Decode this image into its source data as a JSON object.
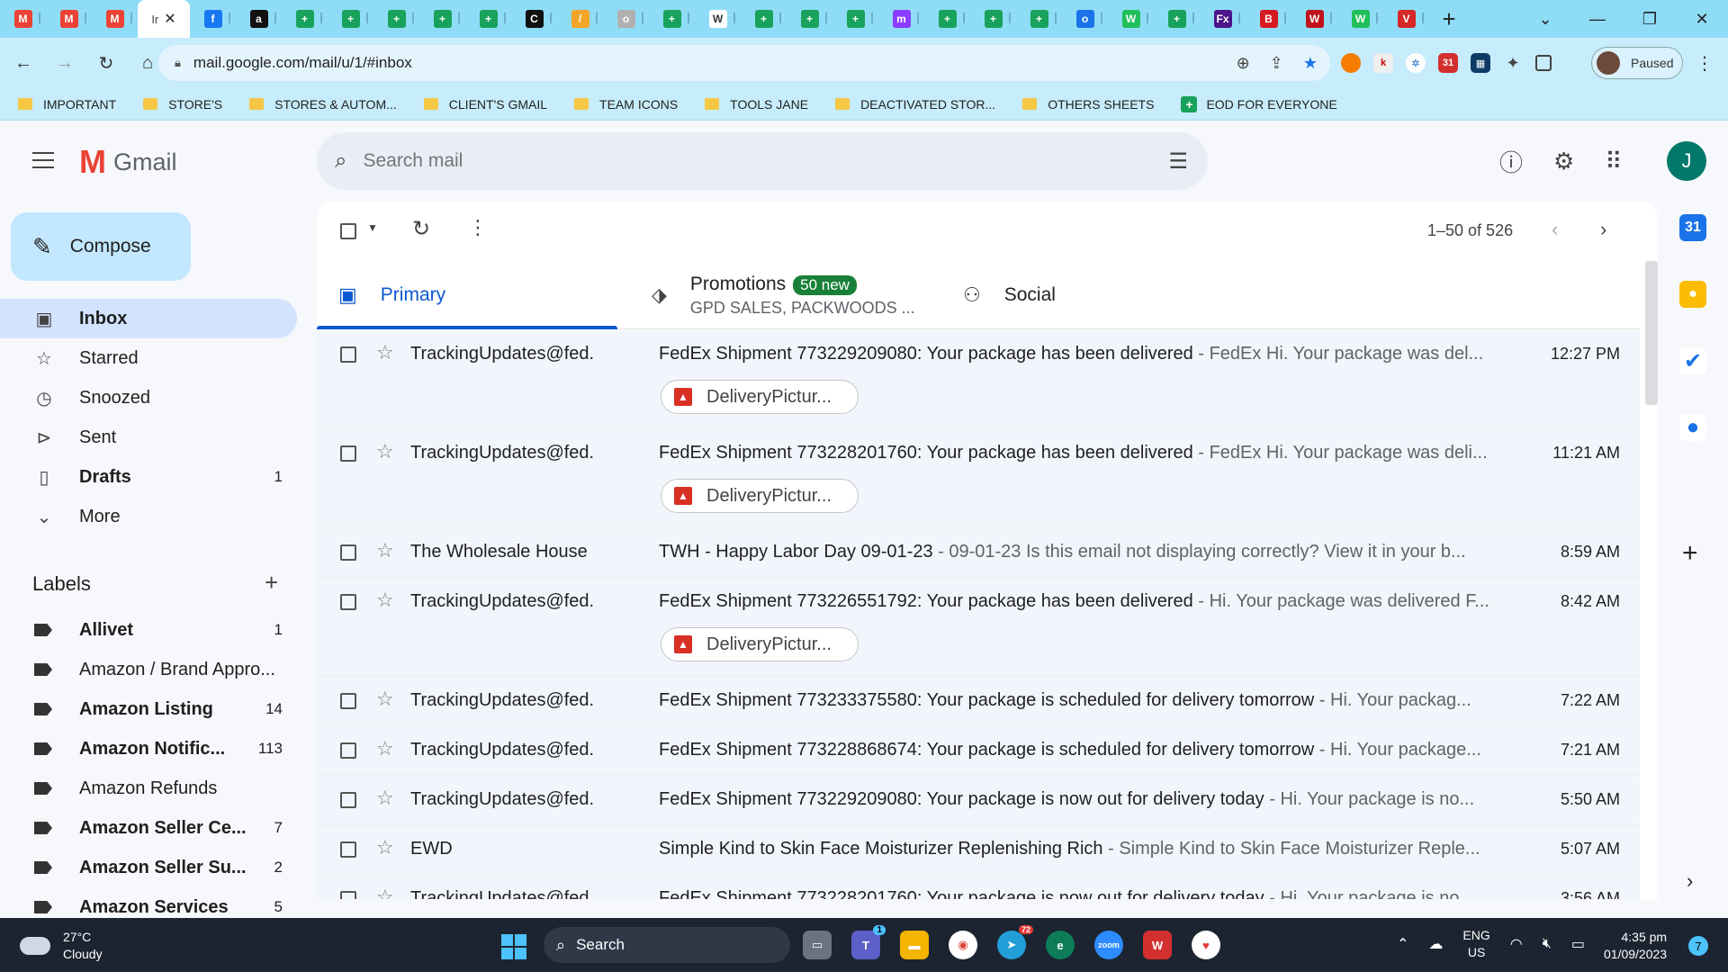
{
  "browser": {
    "tabs": [
      {
        "icon": "gmail-icon",
        "glyph": "M",
        "color": "#ea4335"
      },
      {
        "icon": "gmail-icon",
        "glyph": "M",
        "color": "#ea4335"
      },
      {
        "icon": "gmail-icon",
        "glyph": "M",
        "color": "#ea4335"
      },
      {
        "icon": "facebook-icon",
        "glyph": "f",
        "color": "#1877f2"
      },
      {
        "icon": "amazon-icon",
        "glyph": "a",
        "color": "#111111"
      },
      {
        "icon": "sheets-icon",
        "glyph": "+",
        "color": "#18a25b"
      },
      {
        "icon": "sheets-icon",
        "glyph": "+",
        "color": "#18a25b"
      },
      {
        "icon": "sheets-icon",
        "glyph": "+",
        "color": "#18a25b"
      },
      {
        "icon": "sheets-icon",
        "glyph": "+",
        "color": "#18a25b"
      },
      {
        "icon": "sheets-icon",
        "glyph": "+",
        "color": "#18a25b"
      },
      {
        "icon": "circle-c-icon",
        "glyph": "C",
        "color": "#111111"
      },
      {
        "icon": "feather-icon",
        "glyph": "/",
        "color": "#f4a52a"
      },
      {
        "icon": "globe-icon",
        "glyph": "o",
        "color": "#b0b0b0"
      },
      {
        "icon": "sheets-icon",
        "glyph": "+",
        "color": "#18a25b"
      },
      {
        "icon": "doc-icon",
        "glyph": "W",
        "color": "#ffffff"
      },
      {
        "icon": "sheets-icon",
        "glyph": "+",
        "color": "#18a25b"
      },
      {
        "icon": "sheets-icon",
        "glyph": "+",
        "color": "#18a25b"
      },
      {
        "icon": "sheets-icon",
        "glyph": "+",
        "color": "#18a25b"
      },
      {
        "icon": "messenger-icon",
        "glyph": "m",
        "color": "#8b3dff"
      },
      {
        "icon": "sheets-icon",
        "glyph": "+",
        "color": "#18a25b"
      },
      {
        "icon": "sheets-icon",
        "glyph": "+",
        "color": "#18a25b"
      },
      {
        "icon": "sheets-icon",
        "glyph": "+",
        "color": "#18a25b"
      },
      {
        "icon": "globe-blue-icon",
        "glyph": "o",
        "color": "#1a73e8"
      },
      {
        "icon": "w-green-icon",
        "glyph": "W",
        "color": "#1fbf5a"
      },
      {
        "icon": "sheets-icon",
        "glyph": "+",
        "color": "#18a25b"
      },
      {
        "icon": "fedex-icon",
        "glyph": "Fx",
        "color": "#4d148c"
      },
      {
        "icon": "big-icon",
        "glyph": "B",
        "color": "#d71920"
      },
      {
        "icon": "vw-icon",
        "glyph": "W",
        "color": "#c0121a"
      },
      {
        "icon": "w-green-icon",
        "glyph": "W",
        "color": "#1fbf5a"
      },
      {
        "icon": "triangle-icon",
        "glyph": "V",
        "color": "#d62828"
      }
    ],
    "active_tab_text": "Ir",
    "url": "mail.google.com/mail/u/1/#inbox",
    "profile_status": "Paused",
    "bookmarks": [
      {
        "label": "IMPORTANT",
        "type": "folder"
      },
      {
        "label": "STORE'S",
        "type": "folder"
      },
      {
        "label": "STORES & AUTOM...",
        "type": "folder"
      },
      {
        "label": "CLIENT'S GMAIL",
        "type": "folder"
      },
      {
        "label": "TEAM ICONS",
        "type": "folder"
      },
      {
        "label": "TOOLS JANE",
        "type": "folder"
      },
      {
        "label": "DEACTIVATED STOR...",
        "type": "folder"
      },
      {
        "label": "OTHERS SHEETS",
        "type": "folder"
      },
      {
        "label": "EOD FOR EVERYONE",
        "type": "sheet"
      }
    ]
  },
  "gmail": {
    "brand": "Gmail",
    "search_placeholder": "Search mail",
    "avatar_letter": "J",
    "compose_label": "Compose",
    "nav": [
      {
        "label": "Inbox",
        "icon": "inbox-icon",
        "count": "",
        "active": true
      },
      {
        "label": "Starred",
        "icon": "star-icon",
        "count": ""
      },
      {
        "label": "Snoozed",
        "icon": "clock-icon",
        "count": ""
      },
      {
        "label": "Sent",
        "icon": "send-icon",
        "count": ""
      },
      {
        "label": "Drafts",
        "icon": "draft-icon",
        "count": "1",
        "bold": true
      },
      {
        "label": "More",
        "icon": "chevron-down-icon",
        "count": ""
      }
    ],
    "labels_heading": "Labels",
    "labels": [
      {
        "label": "Allivet",
        "count": "1",
        "bold": true
      },
      {
        "label": "Amazon / Brand Appro...",
        "count": ""
      },
      {
        "label": "Amazon Listing",
        "count": "14",
        "bold": true
      },
      {
        "label": "Amazon Notific...",
        "count": "113",
        "bold": true
      },
      {
        "label": "Amazon Refunds",
        "count": ""
      },
      {
        "label": "Amazon Seller Ce...",
        "count": "7",
        "bold": true
      },
      {
        "label": "Amazon Seller Su...",
        "count": "2",
        "bold": true
      },
      {
        "label": "Amazon Services",
        "count": "5",
        "bold": true
      }
    ],
    "pagination": "1–50 of 526",
    "category_tabs": {
      "primary": "Primary",
      "promotions": "Promotions",
      "promotions_badge": "50 new",
      "promotions_sub": "GPD SALES, PACKWOODS ...",
      "social": "Social"
    },
    "emails": [
      {
        "from": "TrackingUpdates@fed.",
        "subject": "FedEx Shipment 773229209080: Your package has been delivered",
        "snippet": " - FedEx Hi. Your package was del...",
        "time": "12:27 PM",
        "attachment": "DeliveryPictur..."
      },
      {
        "from": "TrackingUpdates@fed.",
        "subject": "FedEx Shipment 773228201760: Your package has been delivered",
        "snippet": " - FedEx Hi. Your package was deli...",
        "time": "11:21 AM",
        "attachment": "DeliveryPictur..."
      },
      {
        "from": "The Wholesale House",
        "subject": "TWH - Happy Labor Day 09-01-23",
        "snippet": " - 09-01-23 Is this email not displaying correctly? View it in your b...",
        "time": "8:59 AM",
        "attachment": ""
      },
      {
        "from": "TrackingUpdates@fed.",
        "subject": "FedEx Shipment 773226551792: Your package has been delivered",
        "snippet": " - Hi. Your package was delivered F...",
        "time": "8:42 AM",
        "attachment": "DeliveryPictur..."
      },
      {
        "from": "TrackingUpdates@fed.",
        "subject": "FedEx Shipment 773233375580: Your package is scheduled for delivery tomorrow",
        "snippet": " - Hi. Your packag...",
        "time": "7:22 AM",
        "attachment": ""
      },
      {
        "from": "TrackingUpdates@fed.",
        "subject": "FedEx Shipment 773228868674: Your package is scheduled for delivery tomorrow",
        "snippet": " - Hi. Your package...",
        "time": "7:21 AM",
        "attachment": ""
      },
      {
        "from": "TrackingUpdates@fed.",
        "subject": "FedEx Shipment 773229209080: Your package is now out for delivery today",
        "snippet": " - Hi. Your package is no...",
        "time": "5:50 AM",
        "attachment": ""
      },
      {
        "from": "EWD",
        "subject": "Simple Kind to Skin Face Moisturizer Replenishing Rich",
        "snippet": " - Simple Kind to Skin Face Moisturizer Reple...",
        "time": "5:07 AM",
        "attachment": ""
      },
      {
        "from": "TrackingUpdates@fed.",
        "subject": "FedEx Shipment 773228201760: Your package is now out for delivery today",
        "snippet": " - Hi. Your package is no...",
        "time": "3:56 AM",
        "attachment": ""
      }
    ]
  },
  "taskbar": {
    "temperature": "27°C",
    "weather": "Cloudy",
    "search_label": "Search",
    "lang1": "ENG",
    "lang2": "US",
    "time": "4:35 pm",
    "date": "01/09/2023",
    "notification_count": "7",
    "telegram_badge": "72",
    "teams_badge": "1"
  }
}
